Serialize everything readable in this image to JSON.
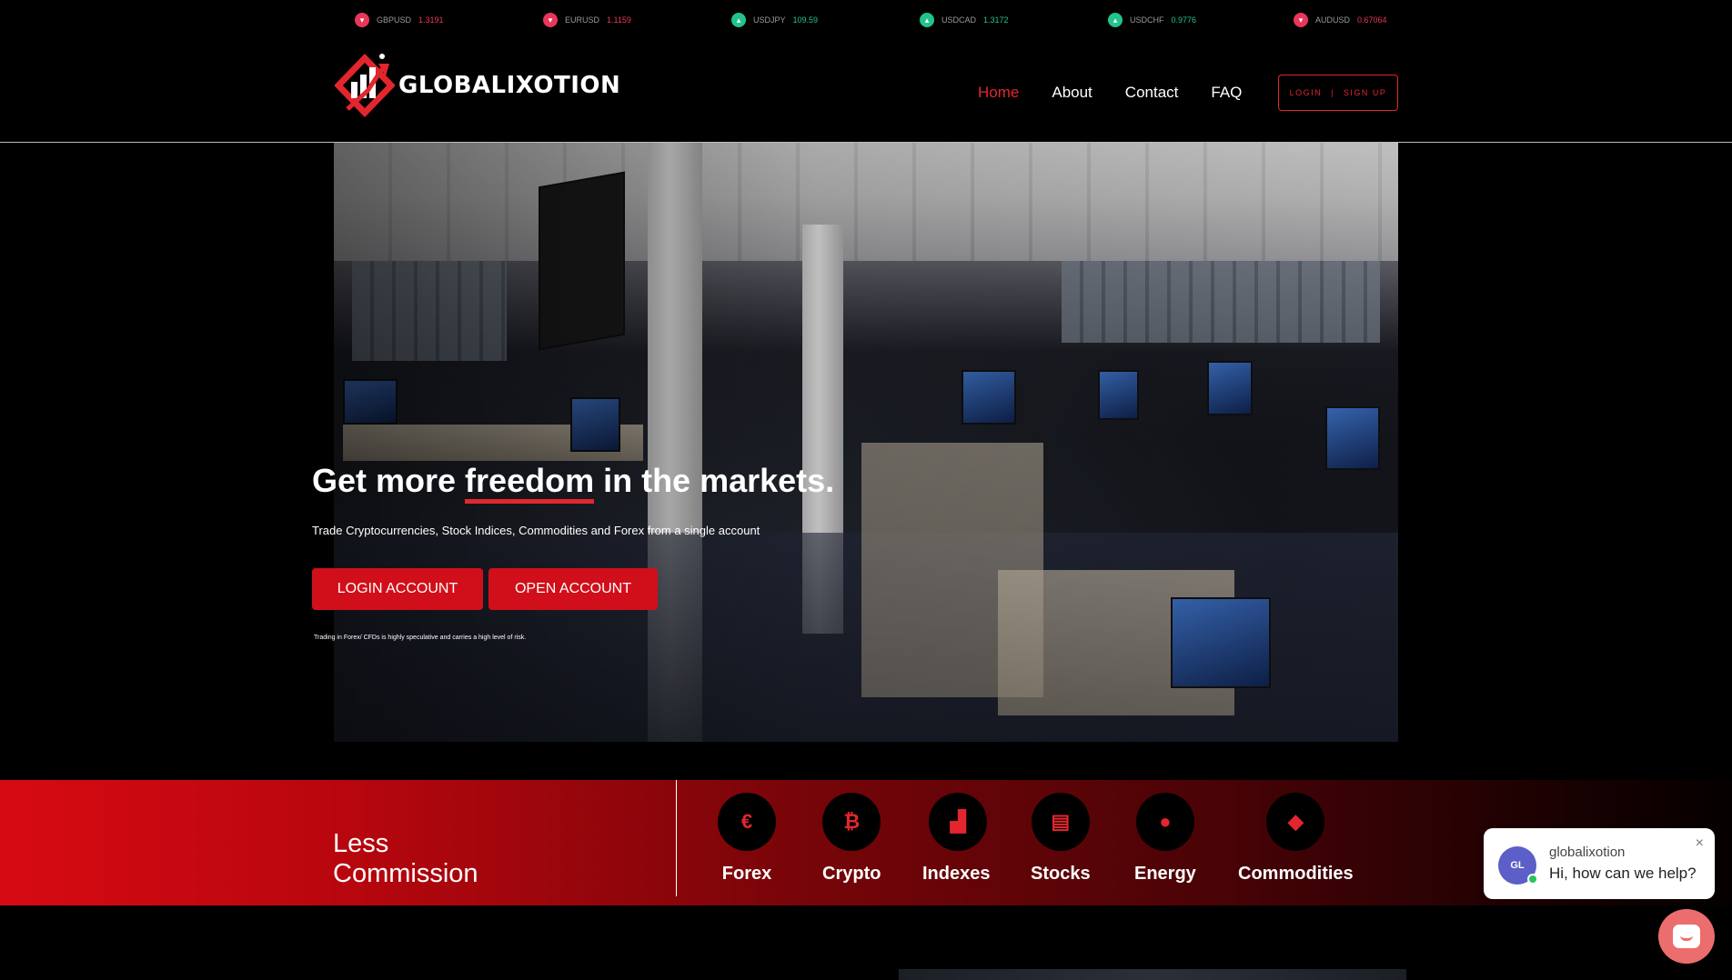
{
  "ticker": [
    {
      "symbol": "GBPUSD",
      "value": "1.3191",
      "dir": "down"
    },
    {
      "symbol": "EURUSD",
      "value": "1.1159",
      "dir": "down"
    },
    {
      "symbol": "USDJPY",
      "value": "109.59",
      "dir": "up"
    },
    {
      "symbol": "USDCAD",
      "value": "1.3172",
      "dir": "up"
    },
    {
      "symbol": "USDCHF",
      "value": "0.9776",
      "dir": "up"
    },
    {
      "symbol": "AUDUSD",
      "value": "0.67064",
      "dir": "down"
    }
  ],
  "brand": {
    "name": "GLOBALIXOTION",
    "accent": "#e3262e"
  },
  "nav": {
    "home": "Home",
    "about": "About",
    "contact": "Contact",
    "faq": "FAQ"
  },
  "auth": {
    "login": "LOGIN",
    "sep": "|",
    "signup": "SIGN UP"
  },
  "hero": {
    "title_before": "Get more ",
    "title_highlight": "freedom",
    "title_after": " in the markets.",
    "subtitle": "Trade Cryptocurrencies, Stock Indices, Commodities and Forex from a single account",
    "login_button": "LOGIN ACCOUNT",
    "open_button": "OPEN ACCOUNT",
    "disclaimer": "Trading in Forex/ CFDs is highly speculative and carries a high level of risk."
  },
  "band": {
    "title_line1": "Less",
    "title_line2": "Commission",
    "categories": [
      {
        "label": "Forex",
        "icon": "euro-icon",
        "glyph": "€"
      },
      {
        "label": "Crypto",
        "icon": "bitcoin-icon",
        "glyph": "₿"
      },
      {
        "label": "Indexes",
        "icon": "area-chart-icon",
        "glyph": "▟"
      },
      {
        "label": "Stocks",
        "icon": "document-chart-icon",
        "glyph": "▤"
      },
      {
        "label": "Energy",
        "icon": "droplet-icon",
        "glyph": "●"
      },
      {
        "label": "Commodities",
        "icon": "cube-icon",
        "glyph": "◆"
      }
    ]
  },
  "chat": {
    "avatar": "GL",
    "name": "globalixotion",
    "message": "Hi, how can we help?",
    "close": "×"
  }
}
